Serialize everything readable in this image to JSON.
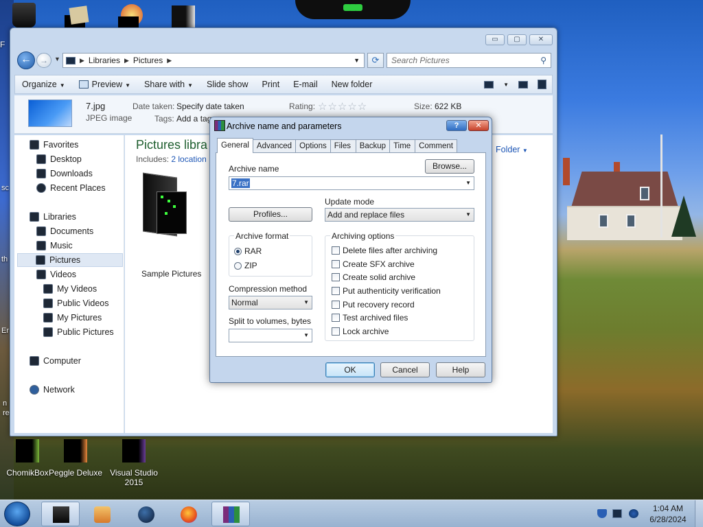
{
  "explorer": {
    "breadcrumb": [
      "Libraries",
      "Pictures"
    ],
    "search_placeholder": "Search Pictures",
    "toolbar": {
      "organize": "Organize",
      "preview": "Preview",
      "share_with": "Share with",
      "slide_show": "Slide show",
      "print": "Print",
      "email": "E-mail",
      "new_folder": "New folder"
    },
    "details": {
      "file_name": "7.jpg",
      "file_type": "JPEG image",
      "date_taken_label": "Date taken:",
      "date_taken_value": "Specify date taken",
      "tags_label": "Tags:",
      "tags_value": "Add a tag",
      "rating_label": "Rating:",
      "rating_stars": "☆☆☆☆☆",
      "size_label": "Size:",
      "size_value": "622 KB"
    },
    "nav": {
      "favorites": "Favorites",
      "desktop": "Desktop",
      "downloads": "Downloads",
      "recent_places": "Recent Places",
      "libraries": "Libraries",
      "documents": "Documents",
      "music": "Music",
      "pictures": "Pictures",
      "videos": "Videos",
      "my_videos": "My Videos",
      "public_videos": "Public Videos",
      "my_pictures": "My Pictures",
      "public_pictures": "Public Pictures",
      "computer": "Computer",
      "network": "Network"
    },
    "content": {
      "title": "Pictures libra",
      "includes_label": "Includes:",
      "includes_link": "2 location",
      "arrange_label": "Folder",
      "folder_name": "Sample Pictures"
    }
  },
  "dialog": {
    "title": "Archive name and parameters",
    "tabs": [
      "General",
      "Advanced",
      "Options",
      "Files",
      "Backup",
      "Time",
      "Comment"
    ],
    "archive_name_label": "Archive name",
    "archive_name_value": "7.rar",
    "browse_button": "Browse...",
    "profiles_button": "Profiles...",
    "update_mode_label": "Update mode",
    "update_mode_value": "Add and replace files",
    "archive_format_label": "Archive format",
    "format_options": [
      "RAR",
      "ZIP"
    ],
    "selected_format": "RAR",
    "compression_label": "Compression method",
    "compression_value": "Normal",
    "split_label": "Split to volumes, bytes",
    "split_value": "",
    "archiving_options_label": "Archiving options",
    "archiving_options": [
      {
        "label": "Delete files after archiving",
        "checked": false
      },
      {
        "label": "Create SFX archive",
        "checked": false
      },
      {
        "label": "Create solid archive",
        "checked": false
      },
      {
        "label": "Put authenticity verification",
        "checked": false
      },
      {
        "label": "Put recovery record",
        "checked": false
      },
      {
        "label": "Test archived files",
        "checked": false
      },
      {
        "label": "Lock archive",
        "checked": false
      }
    ],
    "ok": "OK",
    "cancel": "Cancel",
    "help": "Help",
    "help_icon_label": "?",
    "close_icon_label": "✕"
  },
  "desktop_icons": [
    {
      "label": "ChomikBox"
    },
    {
      "label": "Peggle Deluxe"
    },
    {
      "label": "Visual Studio 2015"
    }
  ],
  "desktop_edge_text": {
    "f": "F",
    "sc": "sc",
    "th": "th",
    "er": "Er",
    "n": "n",
    "re": "re"
  },
  "taskbar": {
    "time": "1:04 AM",
    "date": "6/28/2024"
  },
  "colors": {
    "accent": "#3a71c5",
    "explorer_frame": "#c8d9ee",
    "library_title": "#1e5e2e",
    "link": "#1d56b5"
  }
}
